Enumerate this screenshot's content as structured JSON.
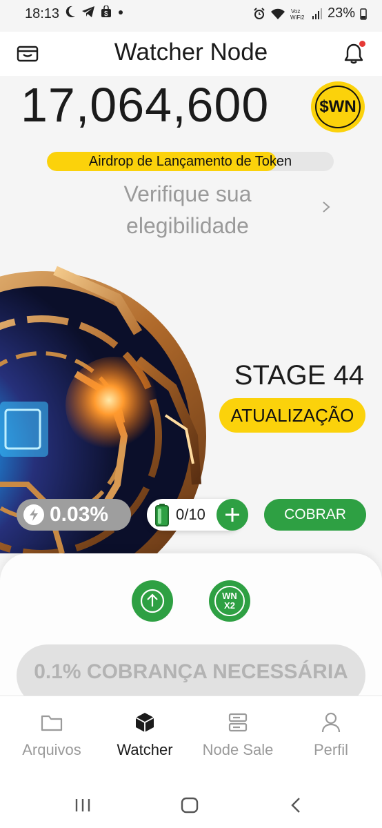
{
  "status_bar": {
    "time": "18:13",
    "left_icons": [
      "moon-icon",
      "telegram-icon",
      "shop-icon",
      "dot-icon"
    ],
    "right_icons": [
      "alarm-icon",
      "wifi-icon",
      "vowifi-icon",
      "signal-icon"
    ],
    "vowifi_text": "Voz\nWiFi2",
    "battery": "23%"
  },
  "header": {
    "title": "Watcher Node",
    "left_icon": "wallet-icon",
    "right_icon": "bell-icon"
  },
  "balance": {
    "amount": "17,064,600",
    "token": "$WN",
    "token_color": "#fbd20b"
  },
  "airdrop": {
    "label": "Airdrop de Lançamento de Token",
    "progress": 0.8
  },
  "verify": {
    "text": "Verifique sua elegibilidade"
  },
  "node": {
    "stage": "STAGE 44",
    "upgrade_label": "ATUALIZAÇÃO",
    "rate": "0.03%",
    "battery_count": "0/10",
    "collect_label": "COBRAR"
  },
  "card": {
    "boost_icon": "arrow-up-circle-icon",
    "multiplier_top": "WN",
    "multiplier_bottom": "X2",
    "charge_label": "0.1% COBRANÇA NECESSÁRIA"
  },
  "nav": {
    "items": [
      {
        "label": "Arquivos",
        "icon": "folder-icon",
        "active": false
      },
      {
        "label": "Watcher",
        "icon": "cube-icon",
        "active": true
      },
      {
        "label": "Node Sale",
        "icon": "server-icon",
        "active": false
      },
      {
        "label": "Perfil",
        "icon": "person-icon",
        "active": false
      }
    ]
  },
  "colors": {
    "accent_green": "#2ea043",
    "accent_yellow": "#fbd20b"
  }
}
